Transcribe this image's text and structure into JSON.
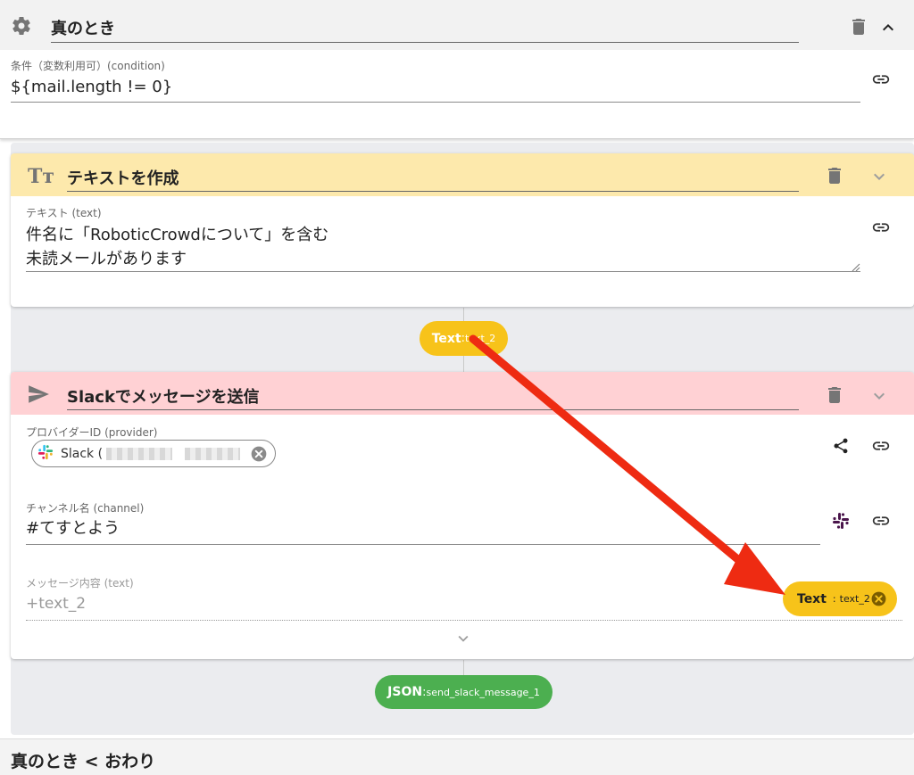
{
  "condition_block": {
    "title": "真のとき",
    "field_label": "条件（変数利用可）(condition)",
    "field_value": "${mail.length != 0}",
    "icons": [
      "gear-icon",
      "trash-icon",
      "chevron-up-icon",
      "link-icon"
    ]
  },
  "text_block": {
    "title": "テキストを作成",
    "field_label": "テキスト (text)",
    "field_value": "件名に「RoboticCrowdについて」を含む\n未読メールがあります",
    "header_color": "#fde9ac",
    "output_pill": {
      "type": "Text",
      "separator": " :",
      "name": "text_2",
      "color": "#f7c31a"
    }
  },
  "slack_block": {
    "title": "Slackでメッセージを送信",
    "header_color": "#ffd1d4",
    "provider": {
      "label": "プロバイダーID (provider)",
      "chip_text": "Slack ("
    },
    "channel": {
      "label": "チャンネル名 (channel)",
      "value": "#てすとよう"
    },
    "message": {
      "label": "メッセージ内容 (text)",
      "placeholder": "+text_2",
      "variable_pill": {
        "type": "Text",
        "name": "text_2"
      }
    },
    "output_pill": {
      "type": "JSON",
      "separator": " :",
      "name": "send_slack_message_1",
      "color": "#4caf50"
    }
  },
  "footer": {
    "title": "真のとき < おわり"
  },
  "colors": {
    "arrow": "#ee2b12",
    "accent_yellow": "#f7c31a",
    "accent_green": "#4caf50"
  }
}
